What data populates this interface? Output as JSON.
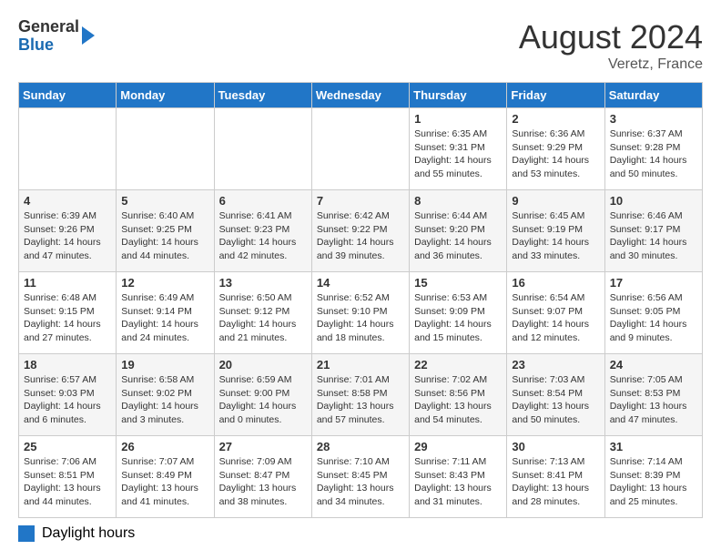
{
  "header": {
    "logo_general": "General",
    "logo_blue": "Blue",
    "month_year": "August 2024",
    "location": "Veretz, France"
  },
  "weekdays": [
    "Sunday",
    "Monday",
    "Tuesday",
    "Wednesday",
    "Thursday",
    "Friday",
    "Saturday"
  ],
  "weeks": [
    [
      {
        "day": "",
        "info": ""
      },
      {
        "day": "",
        "info": ""
      },
      {
        "day": "",
        "info": ""
      },
      {
        "day": "",
        "info": ""
      },
      {
        "day": "1",
        "info": "Sunrise: 6:35 AM\nSunset: 9:31 PM\nDaylight: 14 hours and 55 minutes."
      },
      {
        "day": "2",
        "info": "Sunrise: 6:36 AM\nSunset: 9:29 PM\nDaylight: 14 hours and 53 minutes."
      },
      {
        "day": "3",
        "info": "Sunrise: 6:37 AM\nSunset: 9:28 PM\nDaylight: 14 hours and 50 minutes."
      }
    ],
    [
      {
        "day": "4",
        "info": "Sunrise: 6:39 AM\nSunset: 9:26 PM\nDaylight: 14 hours and 47 minutes."
      },
      {
        "day": "5",
        "info": "Sunrise: 6:40 AM\nSunset: 9:25 PM\nDaylight: 14 hours and 44 minutes."
      },
      {
        "day": "6",
        "info": "Sunrise: 6:41 AM\nSunset: 9:23 PM\nDaylight: 14 hours and 42 minutes."
      },
      {
        "day": "7",
        "info": "Sunrise: 6:42 AM\nSunset: 9:22 PM\nDaylight: 14 hours and 39 minutes."
      },
      {
        "day": "8",
        "info": "Sunrise: 6:44 AM\nSunset: 9:20 PM\nDaylight: 14 hours and 36 minutes."
      },
      {
        "day": "9",
        "info": "Sunrise: 6:45 AM\nSunset: 9:19 PM\nDaylight: 14 hours and 33 minutes."
      },
      {
        "day": "10",
        "info": "Sunrise: 6:46 AM\nSunset: 9:17 PM\nDaylight: 14 hours and 30 minutes."
      }
    ],
    [
      {
        "day": "11",
        "info": "Sunrise: 6:48 AM\nSunset: 9:15 PM\nDaylight: 14 hours and 27 minutes."
      },
      {
        "day": "12",
        "info": "Sunrise: 6:49 AM\nSunset: 9:14 PM\nDaylight: 14 hours and 24 minutes."
      },
      {
        "day": "13",
        "info": "Sunrise: 6:50 AM\nSunset: 9:12 PM\nDaylight: 14 hours and 21 minutes."
      },
      {
        "day": "14",
        "info": "Sunrise: 6:52 AM\nSunset: 9:10 PM\nDaylight: 14 hours and 18 minutes."
      },
      {
        "day": "15",
        "info": "Sunrise: 6:53 AM\nSunset: 9:09 PM\nDaylight: 14 hours and 15 minutes."
      },
      {
        "day": "16",
        "info": "Sunrise: 6:54 AM\nSunset: 9:07 PM\nDaylight: 14 hours and 12 minutes."
      },
      {
        "day": "17",
        "info": "Sunrise: 6:56 AM\nSunset: 9:05 PM\nDaylight: 14 hours and 9 minutes."
      }
    ],
    [
      {
        "day": "18",
        "info": "Sunrise: 6:57 AM\nSunset: 9:03 PM\nDaylight: 14 hours and 6 minutes."
      },
      {
        "day": "19",
        "info": "Sunrise: 6:58 AM\nSunset: 9:02 PM\nDaylight: 14 hours and 3 minutes."
      },
      {
        "day": "20",
        "info": "Sunrise: 6:59 AM\nSunset: 9:00 PM\nDaylight: 14 hours and 0 minutes."
      },
      {
        "day": "21",
        "info": "Sunrise: 7:01 AM\nSunset: 8:58 PM\nDaylight: 13 hours and 57 minutes."
      },
      {
        "day": "22",
        "info": "Sunrise: 7:02 AM\nSunset: 8:56 PM\nDaylight: 13 hours and 54 minutes."
      },
      {
        "day": "23",
        "info": "Sunrise: 7:03 AM\nSunset: 8:54 PM\nDaylight: 13 hours and 50 minutes."
      },
      {
        "day": "24",
        "info": "Sunrise: 7:05 AM\nSunset: 8:53 PM\nDaylight: 13 hours and 47 minutes."
      }
    ],
    [
      {
        "day": "25",
        "info": "Sunrise: 7:06 AM\nSunset: 8:51 PM\nDaylight: 13 hours and 44 minutes."
      },
      {
        "day": "26",
        "info": "Sunrise: 7:07 AM\nSunset: 8:49 PM\nDaylight: 13 hours and 41 minutes."
      },
      {
        "day": "27",
        "info": "Sunrise: 7:09 AM\nSunset: 8:47 PM\nDaylight: 13 hours and 38 minutes."
      },
      {
        "day": "28",
        "info": "Sunrise: 7:10 AM\nSunset: 8:45 PM\nDaylight: 13 hours and 34 minutes."
      },
      {
        "day": "29",
        "info": "Sunrise: 7:11 AM\nSunset: 8:43 PM\nDaylight: 13 hours and 31 minutes."
      },
      {
        "day": "30",
        "info": "Sunrise: 7:13 AM\nSunset: 8:41 PM\nDaylight: 13 hours and 28 minutes."
      },
      {
        "day": "31",
        "info": "Sunrise: 7:14 AM\nSunset: 8:39 PM\nDaylight: 13 hours and 25 minutes."
      }
    ]
  ],
  "legend": {
    "label": "Daylight hours"
  }
}
